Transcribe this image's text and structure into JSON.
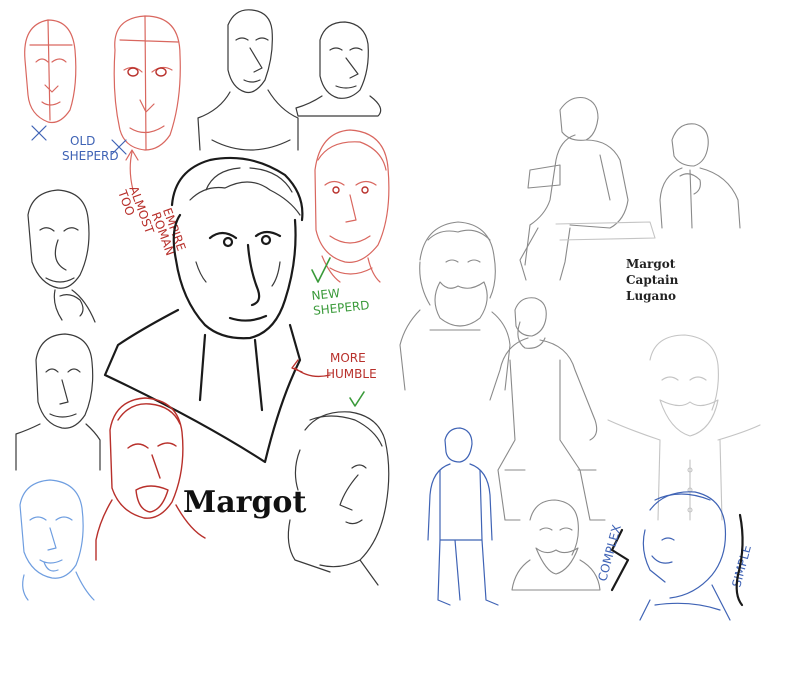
{
  "main_title": "Margot",
  "character_label": [
    "Margot",
    "Captain",
    "Lugano"
  ],
  "annotations": {
    "old_sheperd": [
      "OLD",
      "SHEPERD"
    ],
    "too_much_roman": [
      "TOO",
      "ALMOST",
      "ROMAN",
      "EMPIRE"
    ],
    "new_sheperd": [
      "NEW",
      "SHEPERD"
    ],
    "more_humble": [
      "MORE",
      "HUMBLE"
    ],
    "complex": "COMPLEX",
    "simple": "SIMPLE",
    "rejected_mark": "✕",
    "approved_mark": "✓"
  },
  "colors": {
    "graphite": "#3a3a3a",
    "red_pencil": "#d9675f",
    "red_ink": "#b8302b",
    "blue_pencil": "#3f63b5",
    "light_blue": "#6f9ee0",
    "green_note": "#3a9a3a",
    "light_grey": "#c4c4c4"
  }
}
